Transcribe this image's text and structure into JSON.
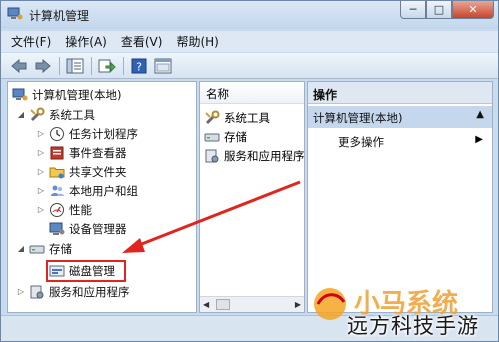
{
  "window": {
    "title": "计算机管理",
    "buttons": {
      "minimize": "─",
      "maximize": "□",
      "close": "✕"
    }
  },
  "menubar": {
    "items": [
      "文件(F)",
      "操作(A)",
      "查看(V)",
      "帮助(H)"
    ]
  },
  "toolbar": {
    "icons": [
      "back-icon",
      "forward-icon",
      "show-tree-icon",
      "export-icon",
      "help-icon",
      "properties-icon"
    ]
  },
  "tree": {
    "root": "计算机管理(本地)",
    "system_tools": "系统工具",
    "items": [
      "任务计划程序",
      "事件查看器",
      "共享文件夹",
      "本地用户和组",
      "性能",
      "设备管理器"
    ],
    "storage": "存储",
    "disk_management": "磁盘管理",
    "services": "服务和应用程序"
  },
  "middle": {
    "column_header": "名称",
    "rows": [
      "系统工具",
      "存储",
      "服务和应用程序"
    ]
  },
  "actions": {
    "header": "操作",
    "group": "计算机管理(本地)",
    "more": "更多操作"
  },
  "watermark": {
    "logo_text": "小马系统",
    "caption": "远方科技手游"
  },
  "colors": {
    "highlight": "#e0251f",
    "arrow": "#e0251f",
    "titlebar": "#c2d6ec"
  }
}
